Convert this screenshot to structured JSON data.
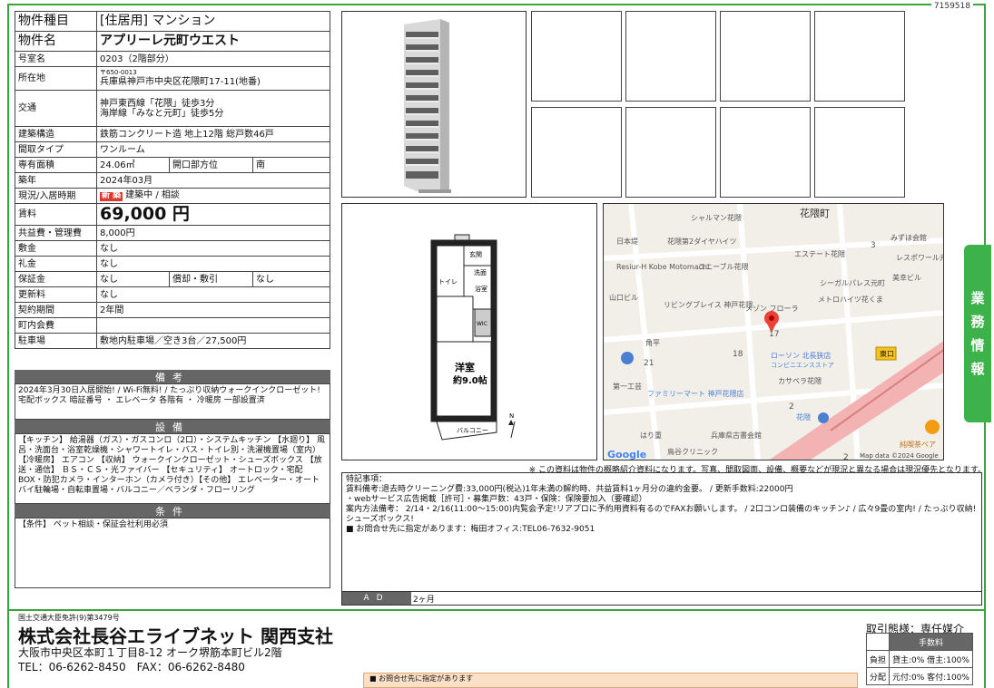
{
  "doc_id": "7159518",
  "property": {
    "type_label": "物件種目",
    "type_value": "[住居用] マンション",
    "name_label": "物件名",
    "name_value": "アプリーレ元町ウエスト",
    "room_label": "号室名",
    "room_value": "0203（2階部分）",
    "loc_label": "所在地",
    "postal": "〒650-0013",
    "address": "兵庫県神戸市中央区花隈町17-11(地番)",
    "access_label": "交通",
    "access1": "神戸東西線「花隈」徒歩3分",
    "access2": "海岸線「みなと元町」徒歩5分",
    "structure_label": "建築構造",
    "structure_value": "鉄筋コンクリート造 地上12階 総戸数46戸",
    "layout_label": "間取タイプ",
    "layout_value": "ワンルーム",
    "area_label": "専有面積",
    "area_value": "24.06㎡",
    "direction_label": "開口部方位",
    "direction_value": "南",
    "built_label": "築年",
    "built_value": "2024年03月",
    "status_label": "現況/入居時期",
    "badge": "新 築",
    "status_value": "建築中 / 相談",
    "rent_label": "賃料",
    "rent_value": "69,000 円",
    "mgmt_label": "共益費・管理費",
    "mgmt_value": "8,000円",
    "deposit_label": "敷金",
    "deposit_value": "なし",
    "key_label": "礼金",
    "key_value": "なし",
    "guarantee_label": "保証金",
    "guarantee_value": "なし",
    "amort_label": "償却・敷引",
    "amort_value": "なし",
    "renew_label": "更新料",
    "renew_value": "なし",
    "term_label": "契約期間",
    "term_value": "2年間",
    "assoc_label": "町内会費",
    "assoc_value": "",
    "parking_label": "駐車場",
    "parking_value": "敷地内駐車場／空き3台／27,500円"
  },
  "biko_head": "備考",
  "biko_text": "2024年3月30日入居開始! / Wi-Fi無料! / たっぷり収納ウォークインクローゼット! 宅配ボックス 暗証番号 ・ エレベータ 各階有 ・ 冷暖房 一部設置済",
  "setsubi_head": "設備",
  "setsubi_text": "【キッチン】 給湯器（ガス）・ガスコンロ（2口）・システムキッチン 【水廻り】 風呂・洗面台・浴室乾燥機・シャワートイレ・バス・トイレ別・洗濯機置場（室内）【冷暖房】 エアコン 【収納】 ウォークインクローゼット・シューズボックス 【放送・通信】 ＢＳ・ＣＳ・光ファイバー 【セキュリティ】 オートロック・宅配BOX・防犯カメラ・インターホン（カメラ付き）【その他】 エレベーター・オートバイ駐輪場・自転車置場・バルコニー／ベランダ・フローリング",
  "joken_head": "条件",
  "joken_text": "【条件】 ペット相談・保証会社利用必須",
  "floorplan": {
    "room": "洋室",
    "size": "約9.0帖",
    "balcony": "バルコニー",
    "entrance": "玄関",
    "wash": "洗面",
    "bath": "浴室",
    "toilet": "トイレ",
    "wic": "WIC",
    "north": "N"
  },
  "map": {
    "labels": [
      "シャルマン花隈",
      "花隈町",
      "日本堤",
      "花隈第2ダイヤハイツ",
      "みずほ会館",
      "エステート花隈",
      "レスポワール元",
      "Resiur-H Kobe Motomachi",
      "ユニーブル花隈",
      "シーガルパレス元町",
      "美幸ビル",
      "山口ビル",
      "リビングブレイス 神戸花隈",
      "メゾン フローラ",
      "メトロハイツ花くま",
      "角平",
      "ローソン 北長狭店",
      "コンビニエンスストア",
      "東口",
      "カサベラ花隈",
      "第一工芸",
      "ファミリーマート 神戸花隈店",
      "兵庫県古書会館",
      "花隈",
      "はり重",
      "鳥谷クリニック",
      "純喫茶ベア"
    ],
    "numbers": [
      "3",
      "17",
      "18",
      "21",
      "2",
      "2"
    ],
    "google": "Google",
    "copyright": "Map data ©2024 Google"
  },
  "disclaimer": "※ この資料は物件の概略紹介資料になります。写真、間取図面、設備、概要などが現況と異なる場合は現況優先となります。",
  "remarks": {
    "title": "特記事項：",
    "line1": "賃料備考:退去時クリーニング費:33,000円(税込)1年未満の解約時、共益賃料1ヶ月分の違約金要。 / 更新手数料:22000円",
    "line2": "・webサービス広告掲載［許可］・募集戸数：43戸・保険：保険要加入（要確認）",
    "line3": "案内方法備考： 2/14・2/16(11:00～15:00)内覧会予定!リアプロに予約用資料有るのでFAXお願いします。 / 2口コンロ装備のキッチン♪ / 広々9畳の室内! / たっぷり収納!シューズボックス!",
    "line4": "■ お問合せ先に指定があります：梅田オフィス:TEL06-7632-9051"
  },
  "ad_label": "AD",
  "ad_value": "2ヶ月",
  "sidetab": [
    "業",
    "務",
    "情",
    "報"
  ],
  "footer": {
    "license": "国土交通大臣免許(9)第3479号",
    "company": "株式会社長谷エライブネット 関西支社",
    "address": "大阪市中央区本町１丁目8-12 オーク堺筋本町ビル2階",
    "tel": "TEL：06-6262-8450　FAX：06-6262-8480",
    "trade": "取引態様：専任媒介",
    "fee_head": "手数料",
    "fee1_label": "負担",
    "fee1_value": "貸主:0% 借主:100%",
    "fee2_label": "分配",
    "fee2_value": "元付:0% 客付:100%",
    "contact_note": "■ お問合せ先に指定があります",
    "contact_value": "梅田オフィス：TEL06-7632-9051"
  },
  "colors": {
    "accent": "#3aa53a",
    "badge": "#e03a2e",
    "header_gray": "#666666"
  }
}
